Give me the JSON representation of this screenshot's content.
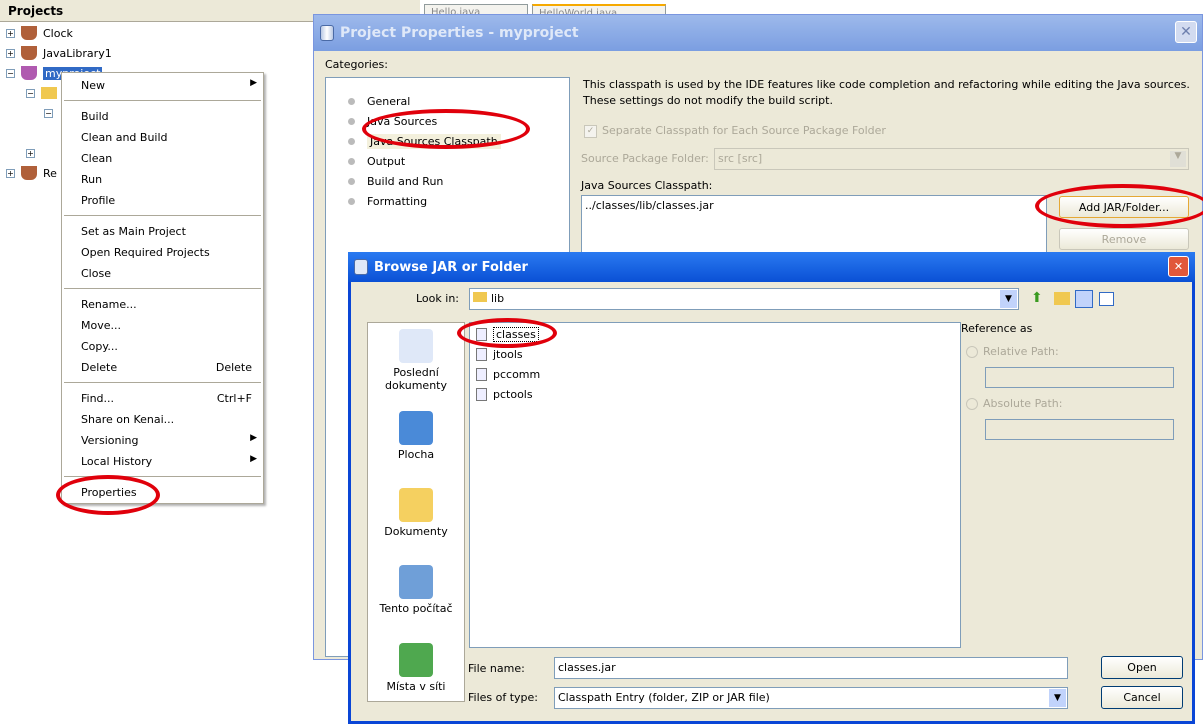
{
  "projects": {
    "title": "Projects",
    "tabs": [
      "Hello.java",
      "HelloWorld.java"
    ],
    "nodes": [
      "Clock",
      "JavaLibrary1",
      "myproject",
      "Re"
    ]
  },
  "context_menu": {
    "items": [
      {
        "label": "New",
        "submenu": true
      },
      {
        "sep": true
      },
      {
        "label": "Build"
      },
      {
        "label": "Clean and Build"
      },
      {
        "label": "Clean"
      },
      {
        "label": "Run"
      },
      {
        "label": "Profile"
      },
      {
        "sep": true
      },
      {
        "label": "Set as Main Project"
      },
      {
        "label": "Open Required Projects"
      },
      {
        "label": "Close"
      },
      {
        "sep": true
      },
      {
        "label": "Rename..."
      },
      {
        "label": "Move..."
      },
      {
        "label": "Copy..."
      },
      {
        "label": "Delete",
        "shortcut": "Delete"
      },
      {
        "sep": true
      },
      {
        "label": "Find...",
        "shortcut": "Ctrl+F"
      },
      {
        "label": "Share on Kenai..."
      },
      {
        "label": "Versioning",
        "submenu": true
      },
      {
        "label": "Local History",
        "submenu": true
      },
      {
        "sep": true
      },
      {
        "label": "Properties"
      }
    ]
  },
  "properties_dialog": {
    "title": "Project Properties - myproject",
    "categories_label": "Categories:",
    "categories": [
      "General",
      "Java Sources",
      "Java Sources Classpath",
      "Output",
      "Build and Run",
      "Formatting"
    ],
    "selected_category": "Java Sources Classpath",
    "description_1": "This classpath is used by the IDE features like code completion and refactoring while editing the Java sources.",
    "description_2": "These settings do not modify the build script.",
    "separate_checkbox": "Separate Classpath for Each Source Package Folder",
    "source_folder_label": "Source Package Folder:",
    "source_folder_value": "src [src]",
    "classpath_label": "Java Sources Classpath:",
    "classpath_entries": [
      "../classes/lib/classes.jar"
    ],
    "add_button": "Add JAR/Folder...",
    "remove_button": "Remove"
  },
  "browse_dialog": {
    "title": "Browse JAR or Folder",
    "look_in_label": "Look in:",
    "look_in_value": "lib",
    "places": [
      "Poslední dokumenty",
      "Plocha",
      "Dokumenty",
      "Tento počítač",
      "Místa v síti"
    ],
    "files": [
      "classes",
      "jtools",
      "pccomm",
      "pctools"
    ],
    "reference_label": "Reference as",
    "relative_path": "Relative Path:",
    "absolute_path": "Absolute Path:",
    "file_name_label": "File name:",
    "file_name_value": "classes.jar",
    "files_of_type_label": "Files of type:",
    "files_of_type_value": "Classpath Entry (folder, ZIP or JAR file)",
    "open_button": "Open",
    "cancel_button": "Cancel"
  },
  "annotation_color": "#e0000b"
}
